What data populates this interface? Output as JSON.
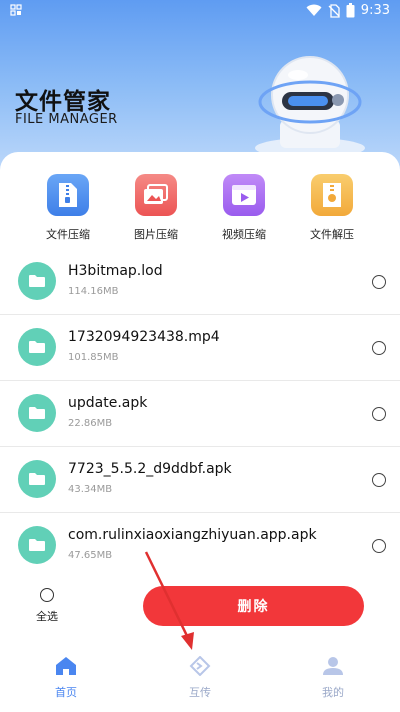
{
  "status_bar": {
    "time": "9:33"
  },
  "hero": {
    "title": "文件管家",
    "subtitle": "FILE MANAGER"
  },
  "tools": [
    {
      "label": "文件压缩",
      "icon": "zip-file-icon",
      "color": "#4f8ff0"
    },
    {
      "label": "图片压缩",
      "icon": "image-compress-icon",
      "color": "#f26a6a"
    },
    {
      "label": "视频压缩",
      "icon": "video-compress-icon",
      "color": "#a86af0"
    },
    {
      "label": "文件解压",
      "icon": "unzip-file-icon",
      "color": "#f5b94e"
    }
  ],
  "files": [
    {
      "name": "H3bitmap.lod",
      "size": "114.16MB"
    },
    {
      "name": "1732094923438.mp4",
      "size": "101.85MB"
    },
    {
      "name": "update.apk",
      "size": "22.86MB"
    },
    {
      "name": "7723_5.5.2_d9ddbf.apk",
      "size": "43.34MB"
    },
    {
      "name": "com.rulinxiaoxiangzhiyuan.app.apk",
      "size": "47.65MB"
    }
  ],
  "actions": {
    "select_all": "全选",
    "delete": "删除"
  },
  "tabs": [
    {
      "label": "首页",
      "active": true
    },
    {
      "label": "互传",
      "active": false
    },
    {
      "label": "我的",
      "active": false
    }
  ],
  "colors": {
    "accent": "#4a86f0",
    "danger": "#f2373a",
    "folder": "#61d0b7"
  }
}
